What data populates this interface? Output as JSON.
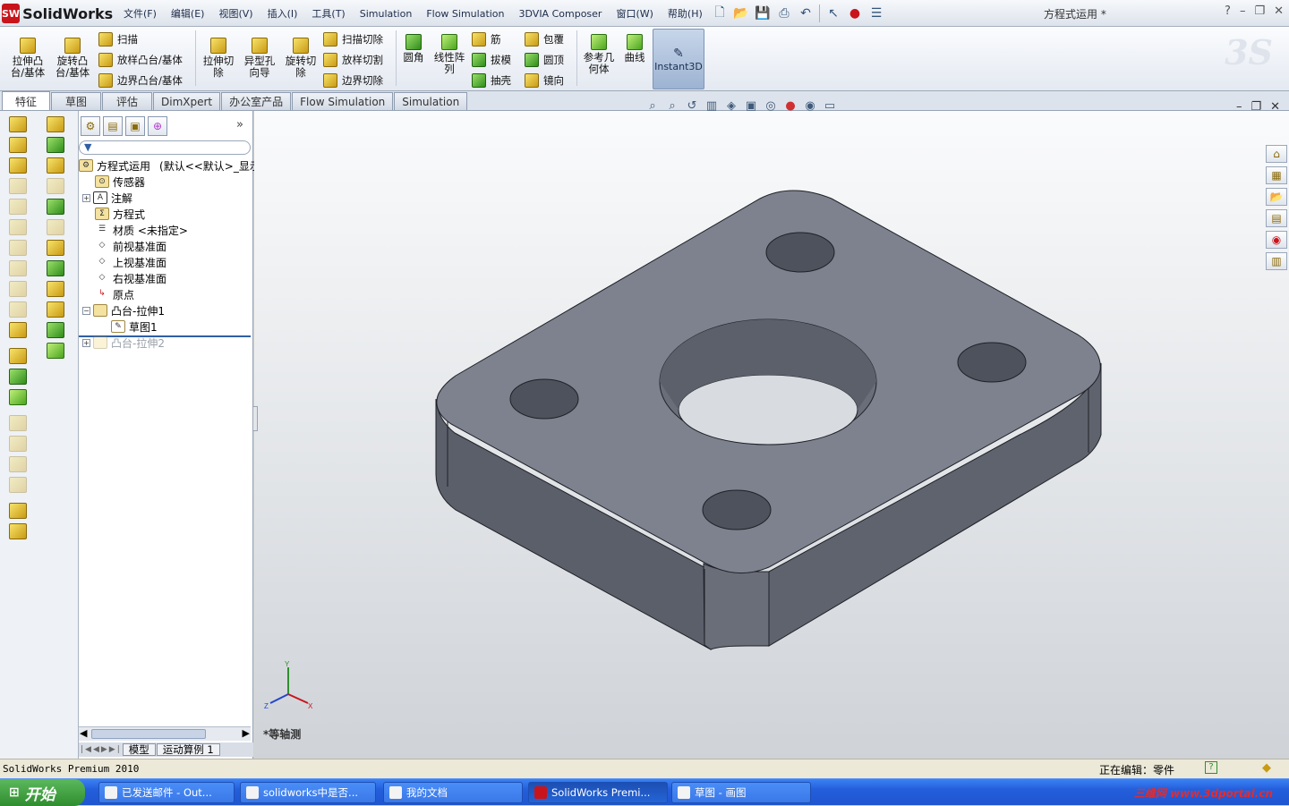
{
  "app": {
    "logo": "SolidWorks",
    "logo_badge": "SW",
    "doc_title": "方程式运用 *"
  },
  "menu": [
    "文件(F)",
    "编辑(E)",
    "视图(V)",
    "插入(I)",
    "工具(T)",
    "Simulation",
    "Flow Simulation",
    "3DVIA Composer",
    "窗口(W)",
    "帮助(H)"
  ],
  "window_controls": [
    "?",
    "–",
    "❐",
    "✕"
  ],
  "ribbon": {
    "extrude_boss": "拉伸凸\n台/基体",
    "revolve_boss": "旋转凸\n台/基体",
    "sweep": "扫描",
    "loft": "放样凸台/基体",
    "boundary": "边界凸台/基体",
    "extrude_cut": "拉伸切\n除",
    "hole_wizard": "异型孔\n向导",
    "revolve_cut": "旋转切\n除",
    "swept_cut": "扫描切除",
    "lofted_cut": "放样切割",
    "boundary_cut": "边界切除",
    "fillet": "圆角",
    "linear_pattern": "线性阵\n列",
    "rib": "筋",
    "draft": "拔模",
    "shell": "抽壳",
    "wrap": "包覆",
    "dome": "圆顶",
    "mirror": "镜向",
    "ref_geometry": "参考几\n何体",
    "curves": "曲线",
    "instant3d": "Instant3D",
    "watermark": "3S"
  },
  "tabs": [
    "特征",
    "草图",
    "评估",
    "DimXpert",
    "办公室产品",
    "Flow Simulation",
    "Simulation"
  ],
  "tree": {
    "root": "方程式运用",
    "root_config": "(默认<<默认>_显示",
    "items": [
      "传感器",
      "注解",
      "方程式",
      "材质 <未指定>",
      "前视基准面",
      "上视基准面",
      "右视基准面",
      "原点",
      "凸台-拉伸1",
      "草图1",
      "凸台-拉伸2"
    ]
  },
  "bottom_tabs": [
    "模型",
    "运动算例 1"
  ],
  "viewport": {
    "view_name": "*等轴测",
    "triad": {
      "x": "X",
      "y": "Y",
      "z": "Z"
    }
  },
  "status": {
    "left": "SolidWorks Premium 2010",
    "editing": "正在编辑：零件"
  },
  "taskbar": {
    "start": "开始",
    "items": [
      "已发送邮件 - Out...",
      "solidworks中是否...",
      "我的文档",
      "SolidWorks Premi...",
      "草图 - 画图"
    ],
    "watermark": "三维网 www.3dportal.cn"
  },
  "colors": {
    "accent": "#2f5fa5",
    "part_top": "#7e838f",
    "part_side": "#5f636e",
    "part_hole": "#4e525c"
  }
}
